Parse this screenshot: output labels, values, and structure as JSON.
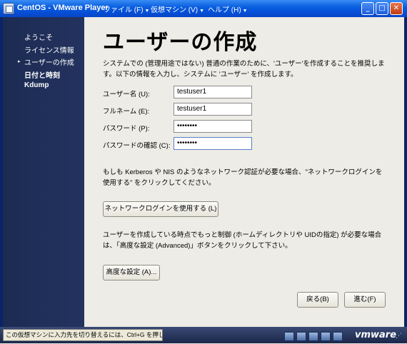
{
  "window": {
    "title": "CentOS - VMware Player",
    "menus": [
      {
        "label": "ファイル (F)"
      },
      {
        "label": "仮想マシン (V)"
      },
      {
        "label": "ヘルプ (H)"
      }
    ],
    "menu_arrow": "▼",
    "minimize_label": "_",
    "maximize_label": "□",
    "close_label": "✕"
  },
  "sidebar": {
    "items": [
      {
        "label": "ようこそ"
      },
      {
        "label": "ライセンス情報"
      },
      {
        "label": "ユーザーの作成"
      },
      {
        "label": "日付と時刻"
      },
      {
        "label": "Kdump"
      }
    ],
    "current_marker": "▸"
  },
  "main": {
    "title": "ユーザーの作成",
    "description": "システムでの (管理用途ではない) 普通の作業のために、'ユーザー'を作成することを推奨します。以下の情報を入力し、システムに 'ユーザー' を作成します。",
    "fields": {
      "username": {
        "label": "ユーザー名 (U):",
        "value": "testuser1"
      },
      "fullname": {
        "label": "フルネーム (E):",
        "value": "testuser1"
      },
      "password": {
        "label": "パスワード (P):",
        "value": "••••••••"
      },
      "confirm": {
        "label": "パスワードの確認 (C):",
        "value": "••••••••"
      }
    },
    "network_note": "もしも Kerberos や NIS のようなネットワーク認証が必要な場合、\"ネットワークログインを使用する\" をクリックしてください。",
    "network_button": "ネットワークログインを使用する (L)",
    "advanced_note": "ユーザーを作成している時点でもっと制御 (ホームディレクトリや UIDの指定) が必要な場合は、「高度な設定 (Advanced)」ボタンをクリックして下さい。",
    "advanced_button": "高度な設定 (A)...",
    "back_button": "戻る(B)",
    "forward_button": "進む(F)"
  },
  "statusbar": {
    "hint": "この仮想マシンに入力先を切り替えるには、Ctrl+G を押してください。",
    "brand": "vmware",
    "grip": "⋰"
  },
  "colors": {
    "titlebar": "#0a5fe0",
    "sidebar": "#1c2b52",
    "content_bg": "#edece6"
  }
}
